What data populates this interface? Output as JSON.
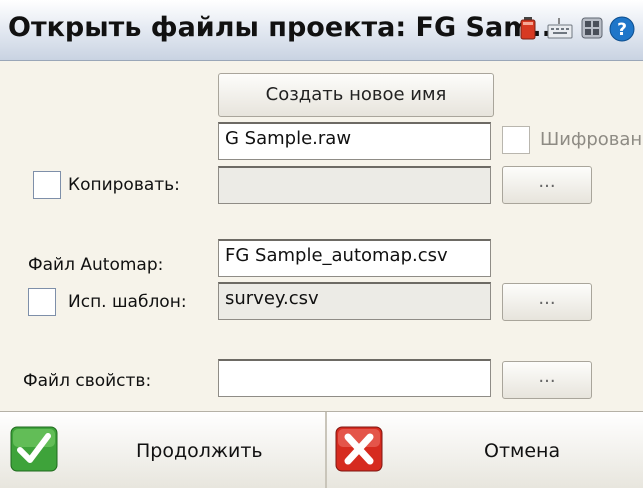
{
  "window": {
    "title": "Открыть файлы проекта: FG Sam...",
    "icons": [
      "battery-icon",
      "keyboard-icon",
      "grid-icon",
      "help-icon"
    ]
  },
  "buttons": {
    "create_new_name": "Создать новое имя",
    "browse_copy": "...",
    "browse_template": "...",
    "browse_properties": "...",
    "continue": "Продолжить",
    "cancel": "Отмена"
  },
  "fields": {
    "raw_file": "G Sample.raw",
    "copy": "",
    "automap_file": "FG Sample_automap.csv",
    "template": "survey.csv",
    "properties_file": ""
  },
  "labels": {
    "copy": "Копировать:",
    "encrypt": "Шифрован",
    "automap": "Файл Automap:",
    "template": "Исп. шаблон:",
    "properties": "Файл свойств:"
  },
  "checkboxes": {
    "copy_checked": false,
    "encrypt_checked": false,
    "template_checked": false
  },
  "colors": {
    "accent_ok": "#2e9a2e",
    "accent_cancel": "#d22a1f",
    "background": "#f6f3ea"
  }
}
